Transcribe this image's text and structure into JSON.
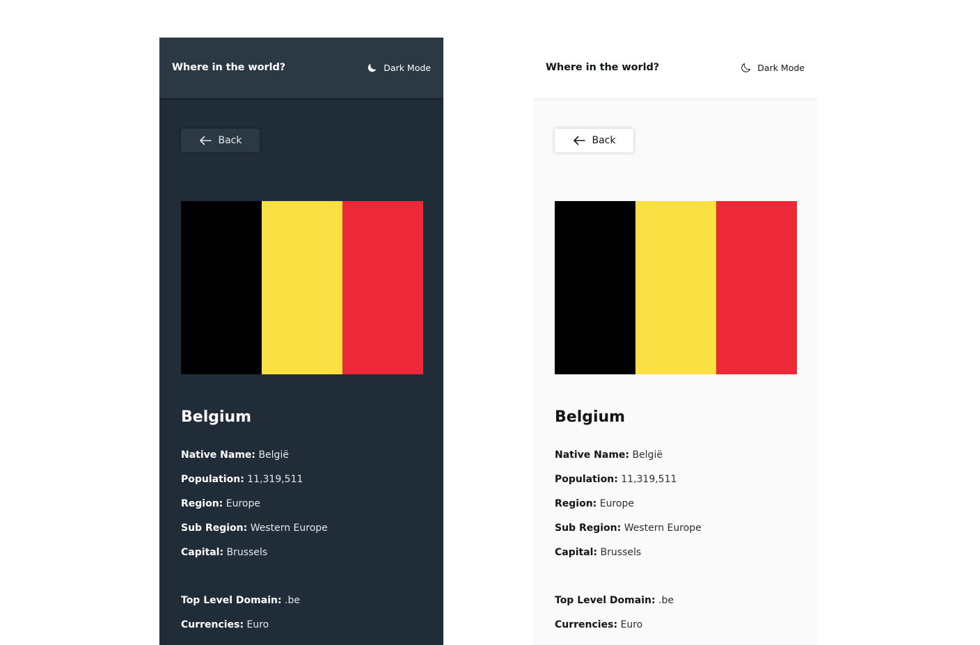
{
  "header": {
    "title": "Where in the world?",
    "mode_label": "Dark Mode",
    "icon": "moon-icon"
  },
  "back_button": {
    "label": "Back",
    "icon": "arrow-left-icon"
  },
  "country": {
    "name": "Belgium",
    "flag_colors": [
      "#000000",
      "#fae042",
      "#ed2939"
    ],
    "details": [
      {
        "label": "Native Name:",
        "value": "België"
      },
      {
        "label": "Population:",
        "value": "11,319,511"
      },
      {
        "label": "Region:",
        "value": "Europe"
      },
      {
        "label": "Sub Region:",
        "value": "Western Europe"
      },
      {
        "label": "Capital:",
        "value": "Brussels"
      },
      {
        "label": "Top Level Domain:",
        "value": ".be"
      },
      {
        "label": "Currencies:",
        "value": "Euro"
      }
    ]
  },
  "themes": {
    "dark": {
      "background": "#202c37",
      "element": "#2b3945",
      "text": "#ffffff"
    },
    "light": {
      "background": "#fafafa",
      "element": "#ffffff",
      "text": "#111517"
    }
  }
}
